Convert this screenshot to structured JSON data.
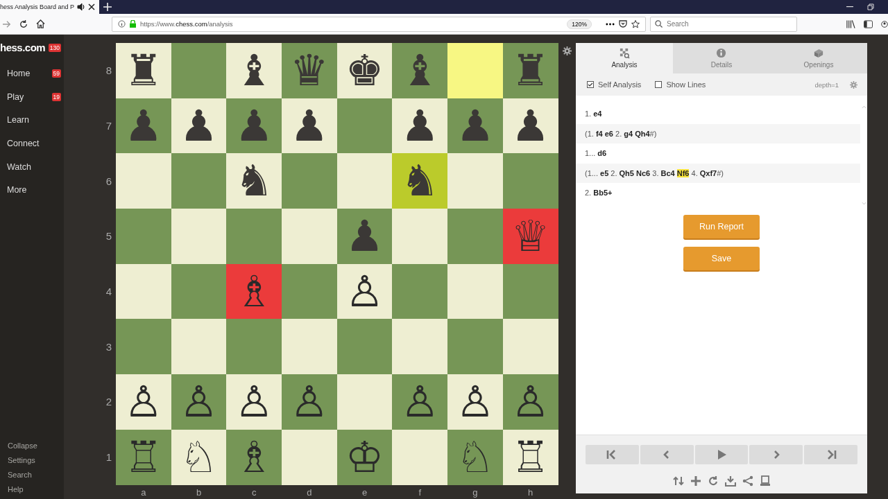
{
  "browser": {
    "tab_title": "hess Analysis Board and P",
    "url_prefix": "https://www.",
    "url_host": "chess.com",
    "url_path": "/analysis",
    "zoom": "120%",
    "search": {
      "placeholder": "Search"
    }
  },
  "sidebar": {
    "logo": "hess.com",
    "logo_badge": "130",
    "items": [
      {
        "label": "Home",
        "badge": "59"
      },
      {
        "label": "Play",
        "badge": "19"
      },
      {
        "label": "Learn"
      },
      {
        "label": "Connect"
      },
      {
        "label": "Watch"
      },
      {
        "label": "More"
      }
    ],
    "footer": [
      "Collapse",
      "Settings",
      "Search",
      "Help"
    ]
  },
  "board": {
    "files": [
      "a",
      "b",
      "c",
      "d",
      "e",
      "f",
      "g",
      "h"
    ],
    "ranks": [
      {
        "label": "8",
        "squares": [
          {
            "kind": "black",
            "piece": "♜"
          },
          {
            "kind": "empty"
          },
          {
            "kind": "black",
            "piece": "♝"
          },
          {
            "kind": "black",
            "piece": "♛"
          },
          {
            "kind": "black",
            "piece": "♚"
          },
          {
            "kind": "black",
            "piece": "♝"
          },
          {
            "kind": "empty",
            "color": "#f7f783"
          },
          {
            "kind": "black",
            "piece": "♜"
          }
        ]
      },
      {
        "label": "7",
        "squares": [
          {
            "kind": "black",
            "piece": "♟"
          },
          {
            "kind": "black",
            "piece": "♟"
          },
          {
            "kind": "black",
            "piece": "♟"
          },
          {
            "kind": "black",
            "piece": "♟"
          },
          {
            "kind": "empty"
          },
          {
            "kind": "black",
            "piece": "♟"
          },
          {
            "kind": "black",
            "piece": "♟"
          },
          {
            "kind": "black",
            "piece": "♟"
          }
        ]
      },
      {
        "label": "6",
        "squares": [
          {
            "kind": "empty"
          },
          {
            "kind": "empty"
          },
          {
            "kind": "black",
            "piece": "♞"
          },
          {
            "kind": "empty"
          },
          {
            "kind": "empty"
          },
          {
            "kind": "black",
            "piece": "♞",
            "color": "#bbcb2b"
          },
          {
            "kind": "empty"
          },
          {
            "kind": "empty"
          }
        ]
      },
      {
        "label": "5",
        "squares": [
          {
            "kind": "empty"
          },
          {
            "kind": "empty"
          },
          {
            "kind": "empty"
          },
          {
            "kind": "empty"
          },
          {
            "kind": "black",
            "piece": "♟"
          },
          {
            "kind": "empty"
          },
          {
            "kind": "empty"
          },
          {
            "kind": "white",
            "piece": "♕",
            "color": "#eb3b3b"
          }
        ]
      },
      {
        "label": "4",
        "squares": [
          {
            "kind": "empty"
          },
          {
            "kind": "empty"
          },
          {
            "kind": "white",
            "piece": "♗",
            "color": "#eb3b3b"
          },
          {
            "kind": "empty"
          },
          {
            "kind": "white",
            "piece": "♙"
          },
          {
            "kind": "empty"
          },
          {
            "kind": "empty"
          },
          {
            "kind": "empty"
          }
        ]
      },
      {
        "label": "3",
        "squares": [
          {
            "kind": "empty"
          },
          {
            "kind": "empty"
          },
          {
            "kind": "empty"
          },
          {
            "kind": "empty"
          },
          {
            "kind": "empty"
          },
          {
            "kind": "empty"
          },
          {
            "kind": "empty"
          },
          {
            "kind": "empty"
          }
        ]
      },
      {
        "label": "2",
        "squares": [
          {
            "kind": "white",
            "piece": "♙"
          },
          {
            "kind": "white",
            "piece": "♙"
          },
          {
            "kind": "white",
            "piece": "♙"
          },
          {
            "kind": "white",
            "piece": "♙"
          },
          {
            "kind": "empty"
          },
          {
            "kind": "white",
            "piece": "♙"
          },
          {
            "kind": "white",
            "piece": "♙"
          },
          {
            "kind": "white",
            "piece": "♙"
          }
        ]
      },
      {
        "label": "1",
        "squares": [
          {
            "kind": "white",
            "piece": "♖"
          },
          {
            "kind": "white",
            "piece": "♘"
          },
          {
            "kind": "white",
            "piece": "♗"
          },
          {
            "kind": "empty"
          },
          {
            "kind": "white",
            "piece": "♔"
          },
          {
            "kind": "empty"
          },
          {
            "kind": "white",
            "piece": "♘"
          },
          {
            "kind": "white",
            "piece": "♖"
          }
        ]
      }
    ]
  },
  "panel": {
    "tabs": [
      {
        "label": "Analysis",
        "selected": true
      },
      {
        "label": "Details",
        "selected": false
      },
      {
        "label": "Openings",
        "selected": false
      }
    ],
    "options": [
      {
        "label": "Self Analysis",
        "checked": true
      },
      {
        "label": "Show Lines",
        "checked": false
      }
    ],
    "depth": "depth=1",
    "moves": [
      {
        "kind": "move",
        "segments": [
          {
            "text": "1. "
          },
          {
            "text": "e4",
            "bold": true
          }
        ]
      },
      {
        "kind": "variation",
        "segments": [
          {
            "text": "(1. "
          },
          {
            "text": "f4 e6",
            "bold": true
          },
          {
            "text": " 2. "
          },
          {
            "text": "g4 Qh4",
            "bold": true
          },
          {
            "text": "#)"
          }
        ]
      },
      {
        "kind": "move",
        "segments": [
          {
            "text": "1... "
          },
          {
            "text": "d6",
            "bold": true
          }
        ]
      },
      {
        "kind": "variation",
        "segments": [
          {
            "text": "(1... "
          },
          {
            "text": "e5",
            "bold": true
          },
          {
            "text": " 2. "
          },
          {
            "text": "Qh5 Nc6",
            "bold": true
          },
          {
            "text": " 3. "
          },
          {
            "text": "Bc4 ",
            "bold": true
          },
          {
            "text": "Nf6",
            "bold": true,
            "highlighted": true
          },
          {
            "text": " 4. "
          },
          {
            "text": "Qxf7",
            "bold": true
          },
          {
            "text": "#)"
          }
        ]
      },
      {
        "kind": "move",
        "segments": [
          {
            "text": "2. "
          },
          {
            "text": "Bb5+",
            "bold": true
          }
        ]
      }
    ],
    "buttons": [
      "Run Report",
      "Save"
    ]
  }
}
